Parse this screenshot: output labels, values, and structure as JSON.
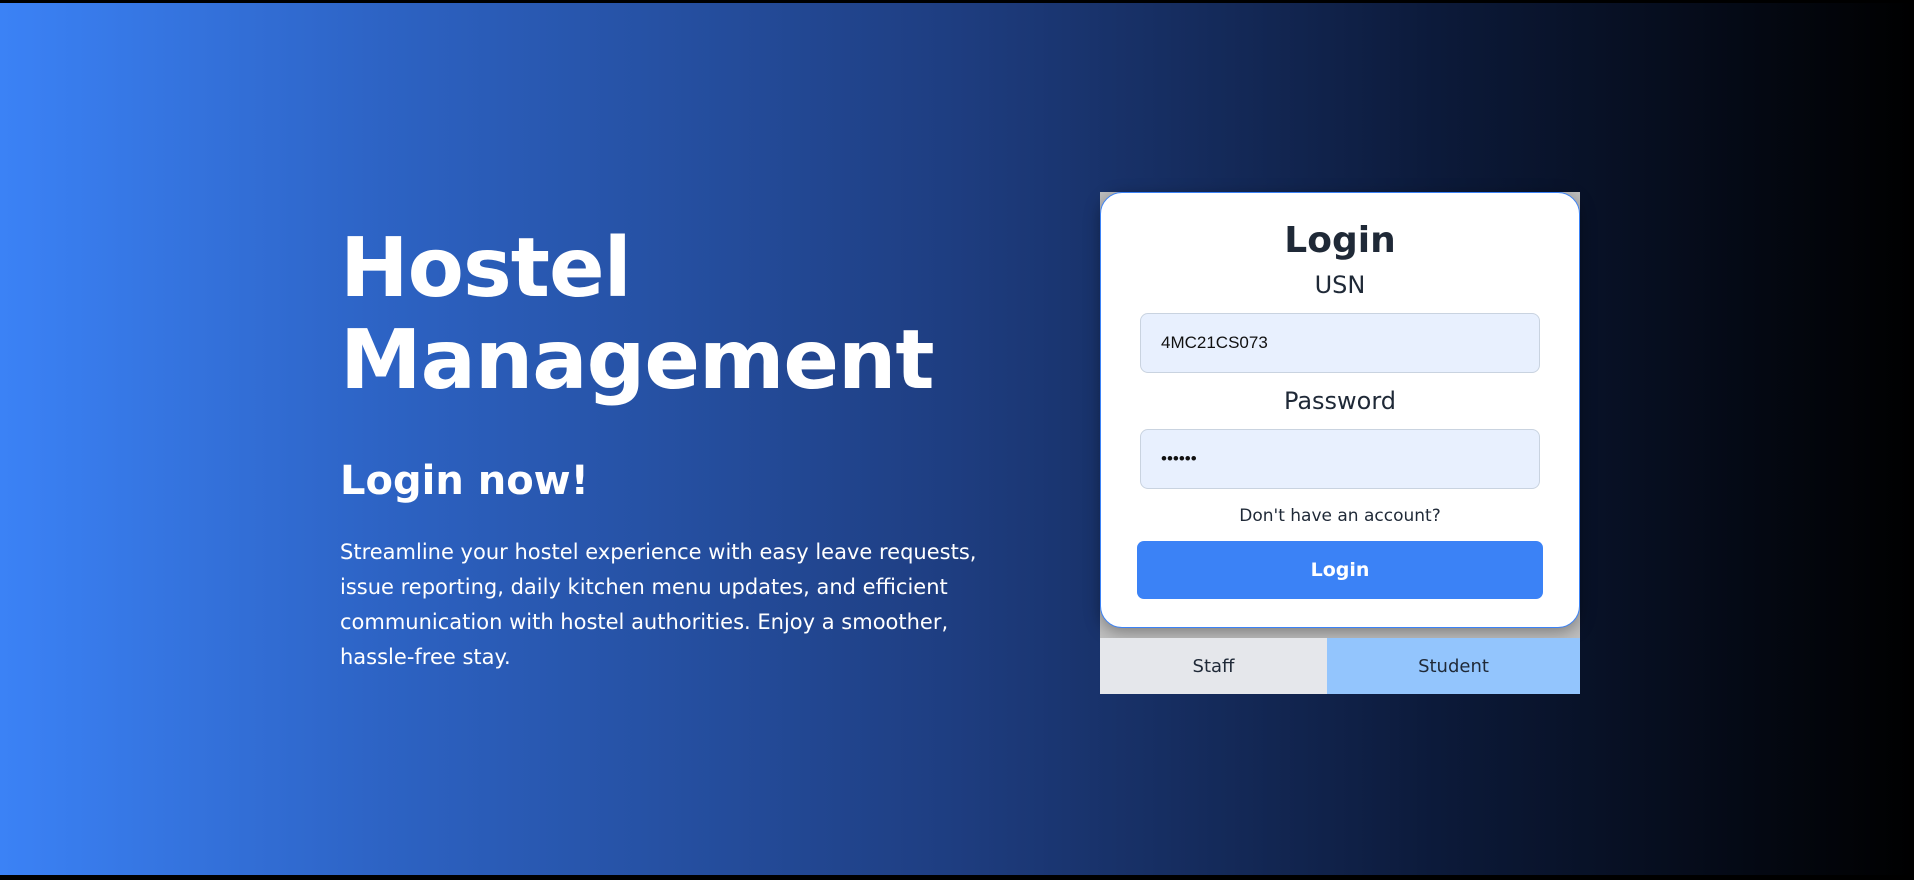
{
  "hero": {
    "title_line1": "Hostel",
    "title_line2": "Management",
    "subtitle": "Login now!",
    "description": "Streamline your hostel experience with easy leave requests, issue reporting, daily kitchen menu updates, and efficient communication with hostel authorities. Enjoy a smoother, hassle-free stay."
  },
  "login_form": {
    "title": "Login",
    "usn_label": "USN",
    "usn_value": "4MC21CS073",
    "password_label": "Password",
    "password_value": "••••••",
    "signup_link": "Don't have an account?",
    "login_button": "Login"
  },
  "role_tabs": {
    "staff": "Staff",
    "student": "Student",
    "selected": "Student"
  },
  "colors": {
    "accent": "#3b82f6",
    "selected_tab": "#93c5fd",
    "unselected_tab": "#e5e7eb",
    "input_background": "#e8f0fe"
  }
}
